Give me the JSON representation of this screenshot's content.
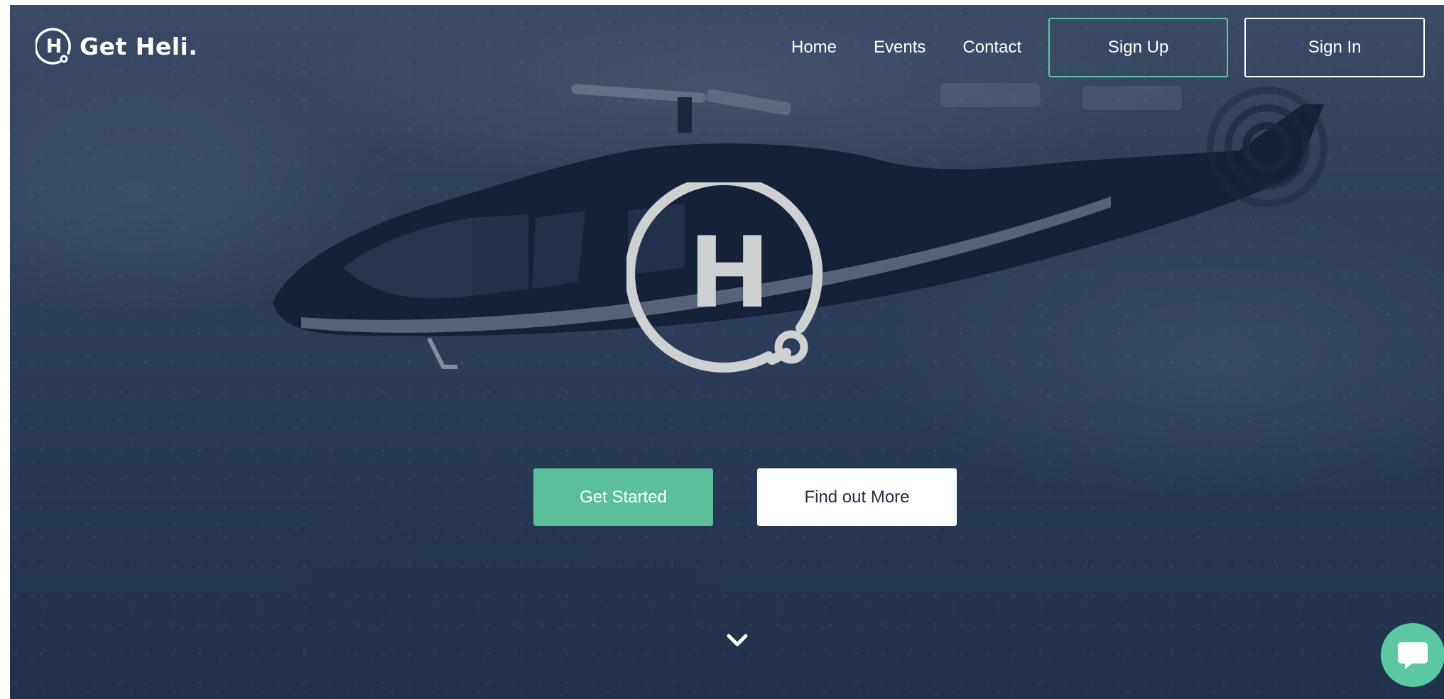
{
  "brand": {
    "name": "Get Heli.",
    "logo_icon": "heli-h-pin-icon"
  },
  "nav": {
    "items": [
      {
        "label": "Home"
      },
      {
        "label": "Events"
      },
      {
        "label": "Contact"
      }
    ],
    "sign_up": "Sign Up",
    "sign_in": "Sign In"
  },
  "hero": {
    "logo_letter": "H",
    "primary_cta": "Get Started",
    "secondary_cta": "Find out More",
    "scroll_icon": "chevron-down-icon"
  },
  "chat": {
    "icon": "chat-bubble-icon"
  },
  "colors": {
    "accent": "#5cc7a3",
    "primary_button": "#5cbf9b",
    "overlay": "#2b3a55",
    "secondary_button_text": "#1f2d45"
  }
}
